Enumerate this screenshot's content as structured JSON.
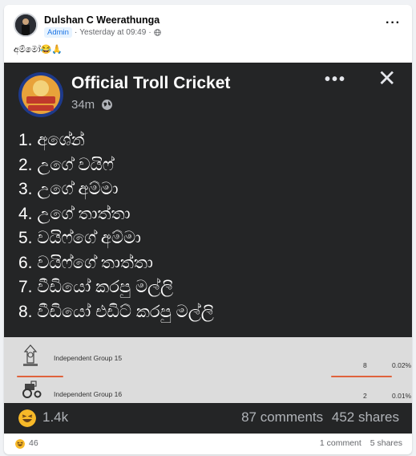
{
  "post": {
    "author": "Dulshan C Weerathunga",
    "role_badge": "Admin",
    "time": "Yesterday at 09:49",
    "separator": "·",
    "caption": "අම්මෝ😂🙏",
    "more_label": "···"
  },
  "shared": {
    "page_name": "Official Troll Cricket",
    "time": "34m",
    "more_label": "•••",
    "close_label": "✕",
    "list": [
      "1. අශේන්",
      "2. උගේ වයිෆ්",
      "3. උගේ අම්මා",
      "4. උගේ තාත්තා",
      "5. වයිෆ්ගේ අම්මා",
      "6. වයිෆ්ගේ තාත්තා",
      "7. වීඩියෝ කරපු මල්ලි",
      "8. වීඩියෝ එඩිට් කරපු මල්ලි"
    ],
    "result_rows": [
      {
        "label": "Independent Group 15",
        "votes": "8",
        "pct": "0.02%"
      },
      {
        "label": "Independent Group 16",
        "votes": "2",
        "pct": "0.01%"
      }
    ],
    "reactions": "1.4k",
    "comments": "87 comments",
    "shares": "452 shares"
  },
  "footer": {
    "reactions": "46",
    "comments": "1 comment",
    "shares": "5 shares"
  },
  "colors": {
    "accent": "#1b74e4",
    "dark_bg": "#242526",
    "reaction": "#f7b928",
    "underline": "#e0623c"
  },
  "icons": [
    "globe-icon",
    "more-icon",
    "close-icon",
    "haha-reaction-icon",
    "ballot-icon",
    "tractor-icon"
  ]
}
